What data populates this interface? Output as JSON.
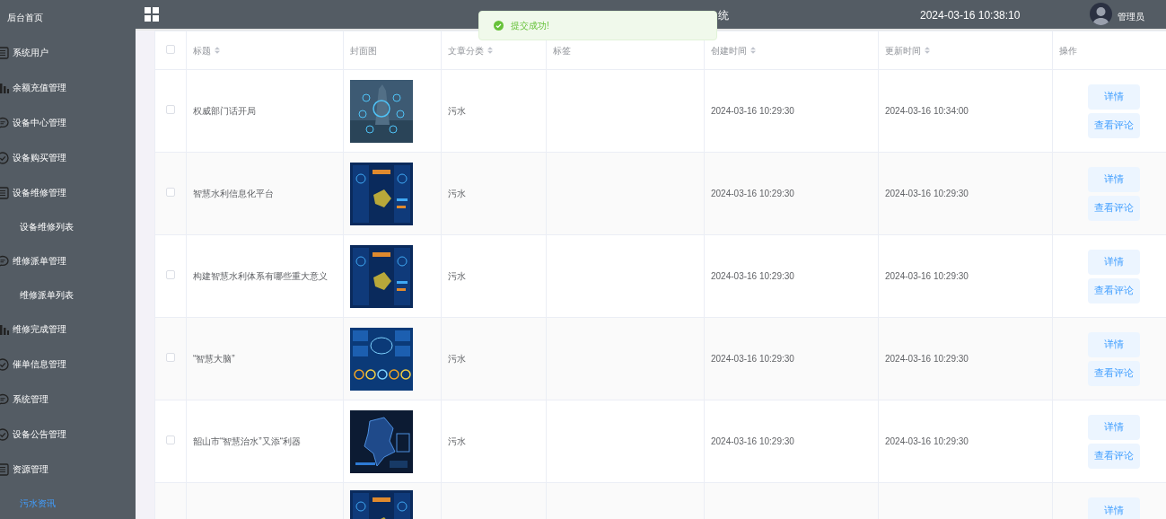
{
  "sidebar": {
    "items": [
      {
        "label": "后台首页",
        "kind": "home",
        "selected": false
      },
      {
        "label": "系统用户",
        "kind": "list",
        "selected": false
      },
      {
        "label": "余额充值管理",
        "kind": "chart",
        "selected": false
      },
      {
        "label": "设备中心管理",
        "kind": "chat",
        "selected": false
      },
      {
        "label": "设备购买管理",
        "kind": "check",
        "selected": false
      },
      {
        "label": "设备维修管理",
        "kind": "list",
        "selected": false
      },
      {
        "label": "设备维修列表",
        "kind": "sub",
        "selected": false
      },
      {
        "label": "维修派单管理",
        "kind": "chat",
        "selected": false
      },
      {
        "label": "维修派单列表",
        "kind": "sub",
        "selected": false
      },
      {
        "label": "维修完成管理",
        "kind": "chart",
        "selected": false
      },
      {
        "label": "催单信息管理",
        "kind": "check",
        "selected": false
      },
      {
        "label": "系统管理",
        "kind": "chat",
        "selected": false
      },
      {
        "label": "设备公告管理",
        "kind": "check",
        "selected": false
      },
      {
        "label": "资源管理",
        "kind": "list",
        "selected": false
      },
      {
        "label": "污水资讯",
        "kind": "sub",
        "selected": true
      }
    ]
  },
  "header": {
    "title": "统",
    "datetime": "2024-03-16 10:38:10",
    "user": "管理员"
  },
  "toast": {
    "message": "提交成功!"
  },
  "table": {
    "select_all": {
      "checked": false
    },
    "columns": [
      {
        "label": "标题",
        "sortable": true
      },
      {
        "label": "封面图",
        "sortable": false
      },
      {
        "label": "文章分类",
        "sortable": true
      },
      {
        "label": "标签",
        "sortable": false
      },
      {
        "label": "创建时间",
        "sortable": true
      },
      {
        "label": "更新时间",
        "sortable": true
      },
      {
        "label": "操作",
        "sortable": false
      }
    ],
    "rows": [
      {
        "checked": false,
        "title": "权威部门话开局",
        "cover": {
          "kind": "picture"
        },
        "category": "污水",
        "created": "2024-03-16 10:29:30",
        "updated": "2024-03-16 10:34:00",
        "actions": [
          "详情",
          "查看评论"
        ]
      },
      {
        "checked": false,
        "title": "智慧水利信息化平台",
        "cover": {
          "kind": "picture"
        },
        "category": "污水",
        "created": "2024-03-16 10:29:30",
        "updated": "2024-03-16 10:29:30",
        "actions": [
          "详情",
          "查看评论"
        ]
      },
      {
        "checked": false,
        "title": "构建智慧水利体系有哪些重大意义",
        "cover": {
          "kind": "picture"
        },
        "category": "污水",
        "created": "2024-03-16 10:29:30",
        "updated": "2024-03-16 10:29:30",
        "actions": [
          "详情",
          "查看评论"
        ]
      },
      {
        "checked": false,
        "title": "“智慧大脑”",
        "cover": {
          "kind": "picture"
        },
        "category": "污水",
        "created": "2024-03-16 10:29:30",
        "updated": "2024-03-16 10:29:30",
        "actions": [
          "详情",
          "查看评论"
        ]
      },
      {
        "checked": false,
        "title": "韶山市“智慧治水”又添“利器",
        "cover": {
          "kind": "picture"
        },
        "category": "污水",
        "created": "2024-03-16 10:29:30",
        "updated": "2024-03-16 10:29:30",
        "actions": [
          "详情",
          "查看评论"
        ]
      },
      {
        "cover": {
          "kind": "picture"
        },
        "actions": [
          "详情"
        ]
      }
    ]
  }
}
